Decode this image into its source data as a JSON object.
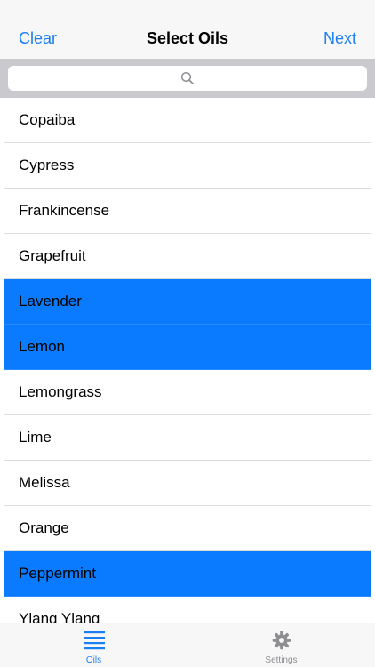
{
  "navbar": {
    "left_label": "Clear",
    "title": "Select Oils",
    "right_label": "Next"
  },
  "search": {
    "placeholder": "",
    "value": ""
  },
  "oils": [
    {
      "name": "Copaiba",
      "selected": false
    },
    {
      "name": "Cypress",
      "selected": false
    },
    {
      "name": "Frankincense",
      "selected": false
    },
    {
      "name": "Grapefruit",
      "selected": false
    },
    {
      "name": "Lavender",
      "selected": true
    },
    {
      "name": "Lemon",
      "selected": true
    },
    {
      "name": "Lemongrass",
      "selected": false
    },
    {
      "name": "Lime",
      "selected": false
    },
    {
      "name": "Melissa",
      "selected": false
    },
    {
      "name": "Orange",
      "selected": false
    },
    {
      "name": "Peppermint",
      "selected": true
    },
    {
      "name": "Ylang Ylang",
      "selected": false
    }
  ],
  "tabbar": {
    "tabs": [
      {
        "label": "Oils",
        "icon": "list-icon",
        "active": true
      },
      {
        "label": "Settings",
        "icon": "gear-icon",
        "active": false
      }
    ]
  },
  "colors": {
    "accent": "#1a7ff2",
    "selected_row": "#0a7bff",
    "inactive_tab": "#8e8e93"
  }
}
